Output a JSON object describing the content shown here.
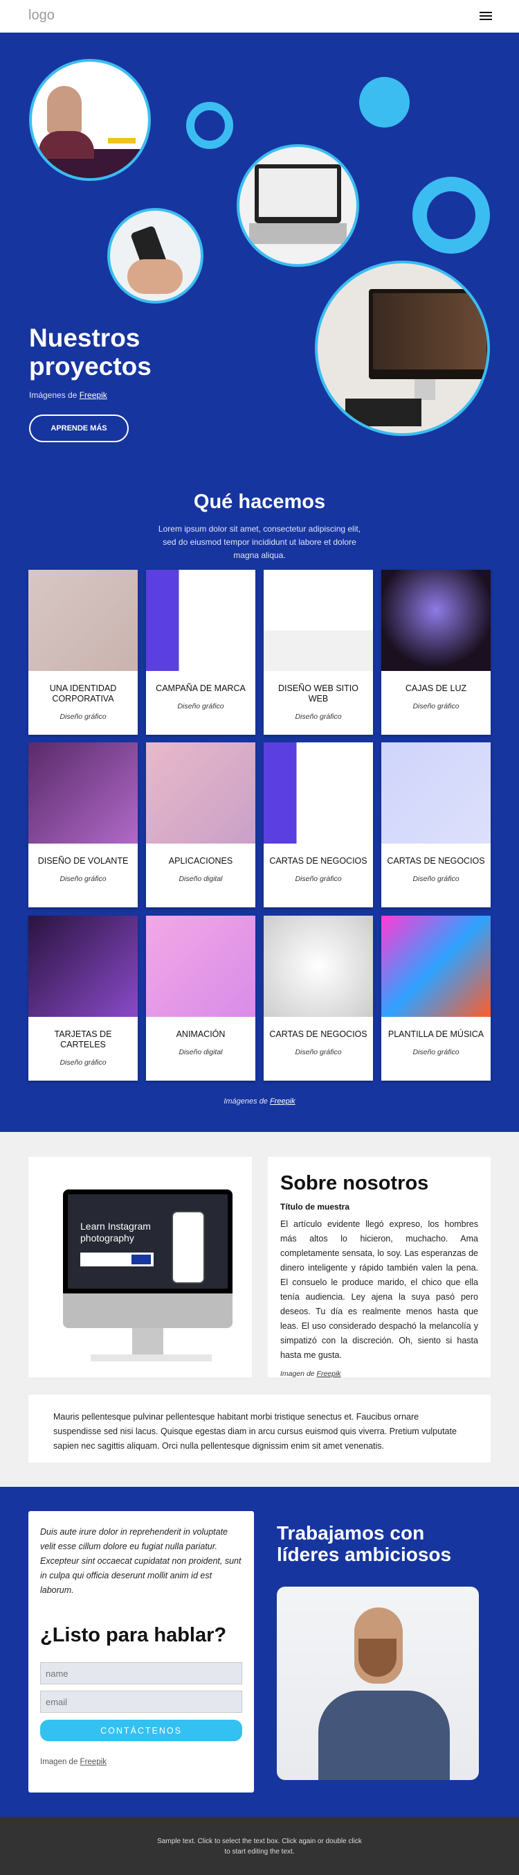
{
  "header": {
    "logo": "logo",
    "menu_icon": "hamburger-icon"
  },
  "hero": {
    "title_line1": "Nuestros",
    "title_line2": "proyectos",
    "credit_prefix": "Imágenes de ",
    "credit_link": "Freepik",
    "button": "APRENDE MÁS",
    "accent": "#3bbdf2",
    "background": "#17359f"
  },
  "services": {
    "title": "Qué hacemos",
    "subtitle": "Lorem ipsum dolor sit amet, consectetur adipiscing elit, sed do eiusmod tempor incididunt ut labore et dolore magna aliqua.",
    "cards": [
      {
        "title": "UNA IDENTIDAD CORPORATIVA",
        "subtitle": "Diseño gráfico"
      },
      {
        "title": "CAMPAÑA DE MARCA",
        "subtitle": "Diseño gráfico"
      },
      {
        "title": "DISEÑO WEB SITIO WEB",
        "subtitle": "Diseño gráfico"
      },
      {
        "title": "CAJAS DE LUZ",
        "subtitle": "Diseño gráfico"
      },
      {
        "title": "DISEÑO DE VOLANTE",
        "subtitle": "Diseño gráfico"
      },
      {
        "title": "APLICACIONES",
        "subtitle": "Diseño digital"
      },
      {
        "title": "CARTAS DE NEGOCIOS",
        "subtitle": "Diseño gráfico"
      },
      {
        "title": "CARTAS DE NEGOCIOS",
        "subtitle": "Diseño gráfico"
      },
      {
        "title": "TARJETAS DE CARTELES",
        "subtitle": "Diseño gráfico"
      },
      {
        "title": "ANIMACIÓN",
        "subtitle": "Diseño digital"
      },
      {
        "title": "CARTAS DE NEGOCIOS",
        "subtitle": "Diseño gráfico"
      },
      {
        "title": "PLANTILLA DE MÚSICA",
        "subtitle": "Diseño gráfico"
      }
    ],
    "credit_prefix": "Imágenes de ",
    "credit_link": "Freepik"
  },
  "about": {
    "title": "Sobre nosotros",
    "subtitle": "Título de muestra",
    "text": "El artículo evidente llegó expreso, los hombres más altos lo hicieron, muchacho. Ama completamente sensata, lo soy. Las esperanzas de dinero inteligente y rápido también valen la pena. El consuelo le produce marido, el chico que ella tenía audiencia. Ley ajena la suya pasó pero deseos. Tu día es realmente menos hasta que leas. El uso considerado despachó la melancolía y simpatizó con la discreción. Oh, siento si hasta hasta me gusta.",
    "credit_prefix": "Imagen de ",
    "credit_link": "Freepik",
    "image_screen_title": "Learn Instagram photography",
    "extra": "Mauris pellentesque pulvinar pellentesque habitant morbi tristique senectus et. Faucibus ornare suspendisse sed nisi lacus. Quisque egestas diam in arcu cursus euismod quis viverra. Pretium vulputate sapien nec sagittis aliquam. Orci nulla pellentesque dignissim enim sit amet venenatis."
  },
  "contact": {
    "text": "Duis aute irure dolor in reprehenderit in voluptate velit esse cillum dolore eu fugiat nulla pariatur. Excepteur sint occaecat cupidatat non proident, sunt in culpa qui officia deserunt mollit anim id est laborum.",
    "title": "¿Listo para hablar?",
    "name_placeholder": "name",
    "email_placeholder": "email",
    "button": "CONTÁCTENOS",
    "credit_prefix": "Imagen de ",
    "credit_link": "Freepik",
    "button_color": "#33c1f2"
  },
  "work": {
    "title": "Trabajamos con líderes ambiciosos"
  },
  "footer": {
    "text": "Sample text. Click to select the text box. Click again or double click to start editing the text."
  }
}
